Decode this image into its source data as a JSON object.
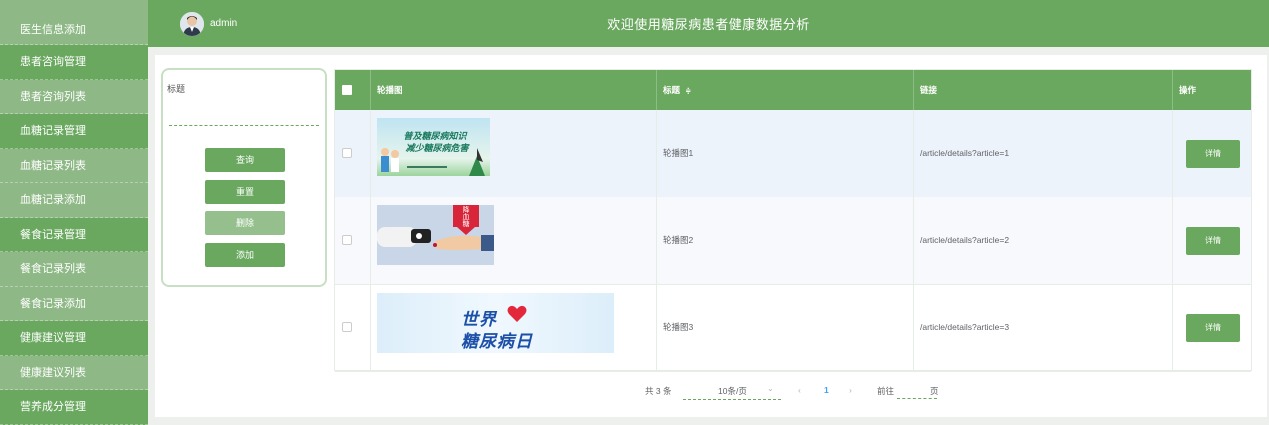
{
  "sidebar": {
    "items": [
      {
        "label": "医生信息添加",
        "group": false
      },
      {
        "label": "患者咨询管理",
        "group": true
      },
      {
        "label": "患者咨询列表",
        "group": false
      },
      {
        "label": "血糖记录管理",
        "group": true
      },
      {
        "label": "血糖记录列表",
        "group": false
      },
      {
        "label": "血糖记录添加",
        "group": false
      },
      {
        "label": "餐食记录管理",
        "group": true
      },
      {
        "label": "餐食记录列表",
        "group": false
      },
      {
        "label": "餐食记录添加",
        "group": false
      },
      {
        "label": "健康建议管理",
        "group": true
      },
      {
        "label": "健康建议列表",
        "group": false
      },
      {
        "label": "营养成分管理",
        "group": true
      }
    ]
  },
  "header": {
    "user": "admin",
    "title": "欢迎使用糖尿病患者健康数据分析"
  },
  "search": {
    "label": "标题",
    "value": "",
    "buttons": {
      "query": "查询",
      "reset": "重置",
      "delete": "删除",
      "add": "添加"
    }
  },
  "table": {
    "headers": {
      "image": "轮播图",
      "title": "标题",
      "link": "链接",
      "action": "操作"
    },
    "sort_icon": "sort-icon",
    "rows": [
      {
        "title": "轮播图1",
        "link": "/article/details?article=1",
        "action": "详情",
        "banner": {
          "lines": [
            "普及糖尿病知识",
            "减少糖尿病危害"
          ]
        }
      },
      {
        "title": "轮播图2",
        "link": "/article/details?article=2",
        "action": "详情",
        "banner": {
          "lines": [
            "降",
            "血",
            "糖"
          ]
        }
      },
      {
        "title": "轮播图3",
        "link": "/article/details?article=3",
        "action": "详情",
        "banner": {
          "lines": [
            "世界",
            "糖尿病日"
          ]
        }
      }
    ]
  },
  "pagination": {
    "total": "共 3 条",
    "page_size": "10条/页",
    "current_page": "1",
    "goto_label": "前往",
    "goto_value": "",
    "page_suffix": "页"
  },
  "colors": {
    "primary": "#6aa860",
    "sidebar": "#8eb886",
    "row_alt": "#edf3fb"
  }
}
